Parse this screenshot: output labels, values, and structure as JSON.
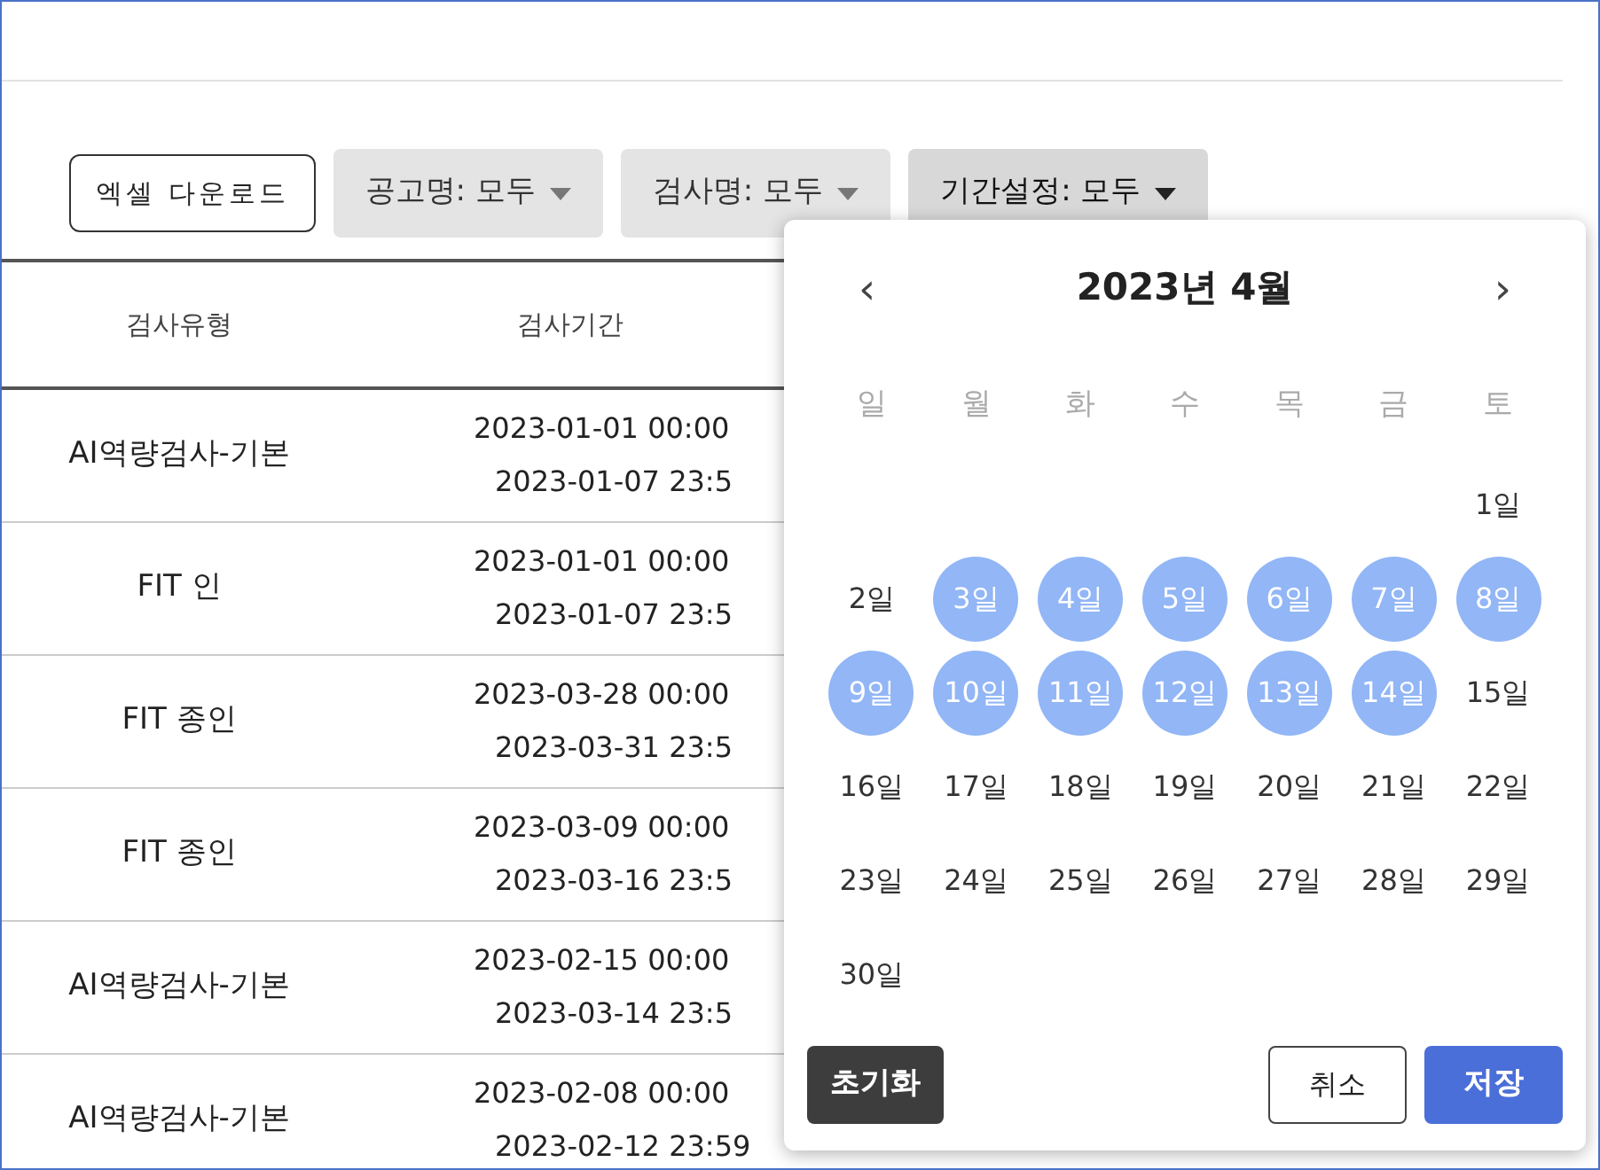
{
  "toolbar": {
    "excel_button": "엑셀 다운로드",
    "filters": [
      {
        "label": "공고명: 모두",
        "active": false
      },
      {
        "label": "검사명: 모두",
        "active": false
      },
      {
        "label": "기간설정: 모두",
        "active": true
      }
    ]
  },
  "table": {
    "columns": [
      "검사유형",
      "검사기간"
    ],
    "rows": [
      {
        "type": "AI역량검사-기본",
        "start": "2023-01-01 00:00",
        "end": "2023-01-07 23:5"
      },
      {
        "type": "FIT 인",
        "start": "2023-01-01 00:00",
        "end": "2023-01-07 23:5"
      },
      {
        "type": "FIT 종인",
        "start": "2023-03-28 00:00",
        "end": "2023-03-31 23:5"
      },
      {
        "type": "FIT 종인",
        "start": "2023-03-09 00:00",
        "end": "2023-03-16 23:5"
      },
      {
        "type": "AI역량검사-기본",
        "start": "2023-02-15 00:00",
        "end": "2023-03-14 23:5"
      },
      {
        "type": "AI역량검사-기본",
        "start": "2023-02-08 00:00",
        "end": "2023-02-12 23:59"
      }
    ]
  },
  "calendar": {
    "prev": "‹",
    "title": "2023년 4월",
    "next": "›",
    "weekdays": [
      "일",
      "월",
      "화",
      "수",
      "목",
      "금",
      "토"
    ],
    "weeks": [
      [
        {
          "label": "1일",
          "selected": false
        }
      ],
      [
        {
          "label": "2일",
          "selected": false
        },
        {
          "label": "3일",
          "selected": true
        },
        {
          "label": "4일",
          "selected": true
        },
        {
          "label": "5일",
          "selected": true
        },
        {
          "label": "6일",
          "selected": true
        },
        {
          "label": "7일",
          "selected": true
        },
        {
          "label": "8일",
          "selected": true
        }
      ],
      [
        {
          "label": "9일",
          "selected": true
        },
        {
          "label": "10일",
          "selected": true
        },
        {
          "label": "11일",
          "selected": true
        },
        {
          "label": "12일",
          "selected": true
        },
        {
          "label": "13일",
          "selected": true
        },
        {
          "label": "14일",
          "selected": true
        },
        {
          "label": "15일",
          "selected": false
        }
      ],
      [
        {
          "label": "16일",
          "selected": false
        },
        {
          "label": "17일",
          "selected": false
        },
        {
          "label": "18일",
          "selected": false
        },
        {
          "label": "19일",
          "selected": false
        },
        {
          "label": "20일",
          "selected": false
        },
        {
          "label": "21일",
          "selected": false
        },
        {
          "label": "22일",
          "selected": false
        }
      ],
      [
        {
          "label": "23일",
          "selected": false
        },
        {
          "label": "24일",
          "selected": false
        },
        {
          "label": "25일",
          "selected": false
        },
        {
          "label": "26일",
          "selected": false
        },
        {
          "label": "27일",
          "selected": false
        },
        {
          "label": "28일",
          "selected": false
        },
        {
          "label": "29일",
          "selected": false
        }
      ],
      [
        {
          "label": "30일",
          "selected": false
        }
      ]
    ],
    "reset": "초기화",
    "cancel": "취소",
    "save": "저장"
  }
}
